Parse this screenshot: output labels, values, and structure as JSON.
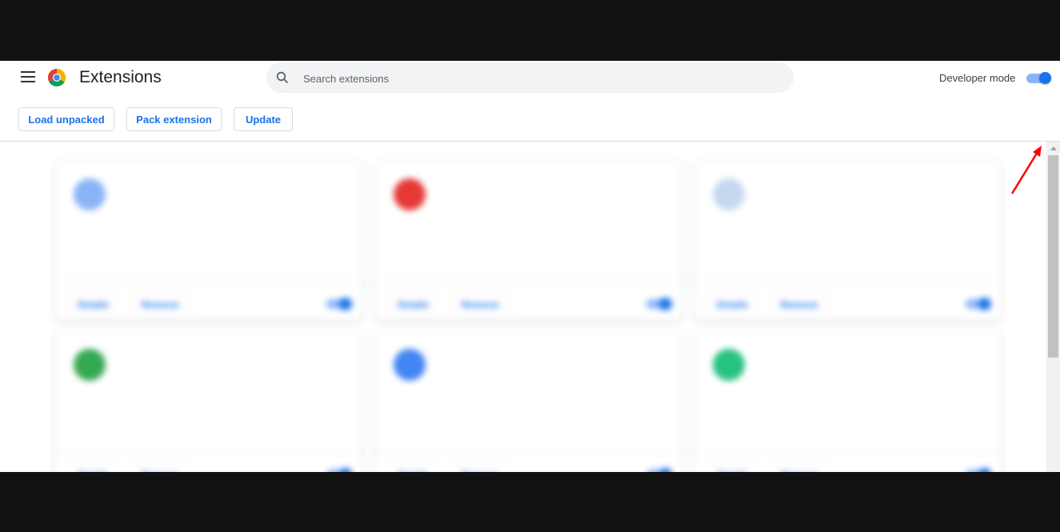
{
  "header": {
    "title": "Extensions",
    "search_placeholder": "Search extensions",
    "developer_mode_label": "Developer mode",
    "developer_mode_on": true
  },
  "toolbar": {
    "load_unpacked": "Load unpacked",
    "pack_extension": "Pack extension",
    "update": "Update"
  },
  "colors": {
    "accent": "#1a73e8",
    "toggle_track": "#8ab4f8",
    "annotation_arrow": "#ff0000"
  },
  "cards": [
    {
      "name": "",
      "description": "",
      "id_line": "",
      "link": "",
      "details_label": "Details",
      "remove_label": "Remove",
      "enabled": true,
      "icon_color": "#8ab4f8"
    },
    {
      "name": "",
      "description": "",
      "id_line": "",
      "link": "",
      "details_label": "Details",
      "remove_label": "Remove",
      "enabled": true,
      "icon_color": "#e53935"
    },
    {
      "name": "",
      "description": "",
      "id_line": "",
      "link": "",
      "details_label": "Details",
      "remove_label": "Remove",
      "enabled": true,
      "icon_color": "#c5d8f0"
    },
    {
      "name": "",
      "description": "",
      "id_line": "",
      "link": "",
      "details_label": "Details",
      "remove_label": "Remove",
      "enabled": true,
      "icon_color": "#34a853"
    },
    {
      "name": "",
      "description": "",
      "id_line": "",
      "link": "",
      "details_label": "Details",
      "remove_label": "Remove",
      "enabled": true,
      "icon_color": "#4285f4"
    },
    {
      "name": "",
      "description": "",
      "id_line": "",
      "link": "",
      "details_label": "Details",
      "remove_label": "Remove",
      "enabled": true,
      "icon_color": "#26c281"
    }
  ]
}
